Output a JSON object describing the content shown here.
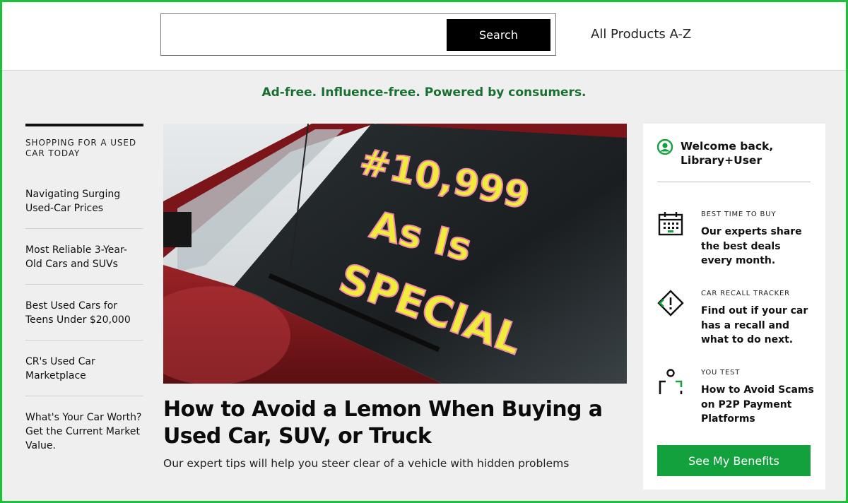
{
  "header": {
    "search_placeholder": "",
    "search_button": "Search",
    "all_products_link": "All Products A-Z"
  },
  "tagline": "Ad-free. Influence-free. Powered by consumers.",
  "left_nav": {
    "heading": "SHOPPING FOR A USED CAR TODAY",
    "items": [
      {
        "label": "Navigating Surging Used-Car Prices"
      },
      {
        "label": "Most Reliable 3-Year-Old Cars and SUVs"
      },
      {
        "label": "Best Used Cars for Teens Under $20,000"
      },
      {
        "label": "CR's Used Car Marketplace"
      },
      {
        "label": "What's Your Car Worth? Get the Current Market Value."
      }
    ]
  },
  "hero": {
    "windshield_text": [
      "#10,999",
      "As Is",
      "SPECIAL"
    ],
    "title": "How to Avoid a Lemon When Buying a Used Car, SUV, or Truck",
    "subtitle": "Our expert tips will help you steer clear of a vehicle with hidden problems"
  },
  "member_panel": {
    "welcome": "Welcome back, Library+User",
    "benefits": [
      {
        "icon": "calendar-icon",
        "label": "BEST TIME TO BUY",
        "description": "Our experts share the best deals every month."
      },
      {
        "icon": "recall-alert-icon",
        "label": "CAR RECALL TRACKER",
        "description": "Find out if your car has a recall and what to do next."
      },
      {
        "icon": "person-frame-icon",
        "label": "YOU TEST",
        "description": "How to Avoid Scams on P2P Payment Platforms"
      }
    ],
    "cta_button": "See My Benefits"
  },
  "colors": {
    "brand_green": "#12a13c",
    "tagline_green": "#1b6e32",
    "page_bg": "#efefef",
    "frame_green": "#1fbf3a"
  }
}
